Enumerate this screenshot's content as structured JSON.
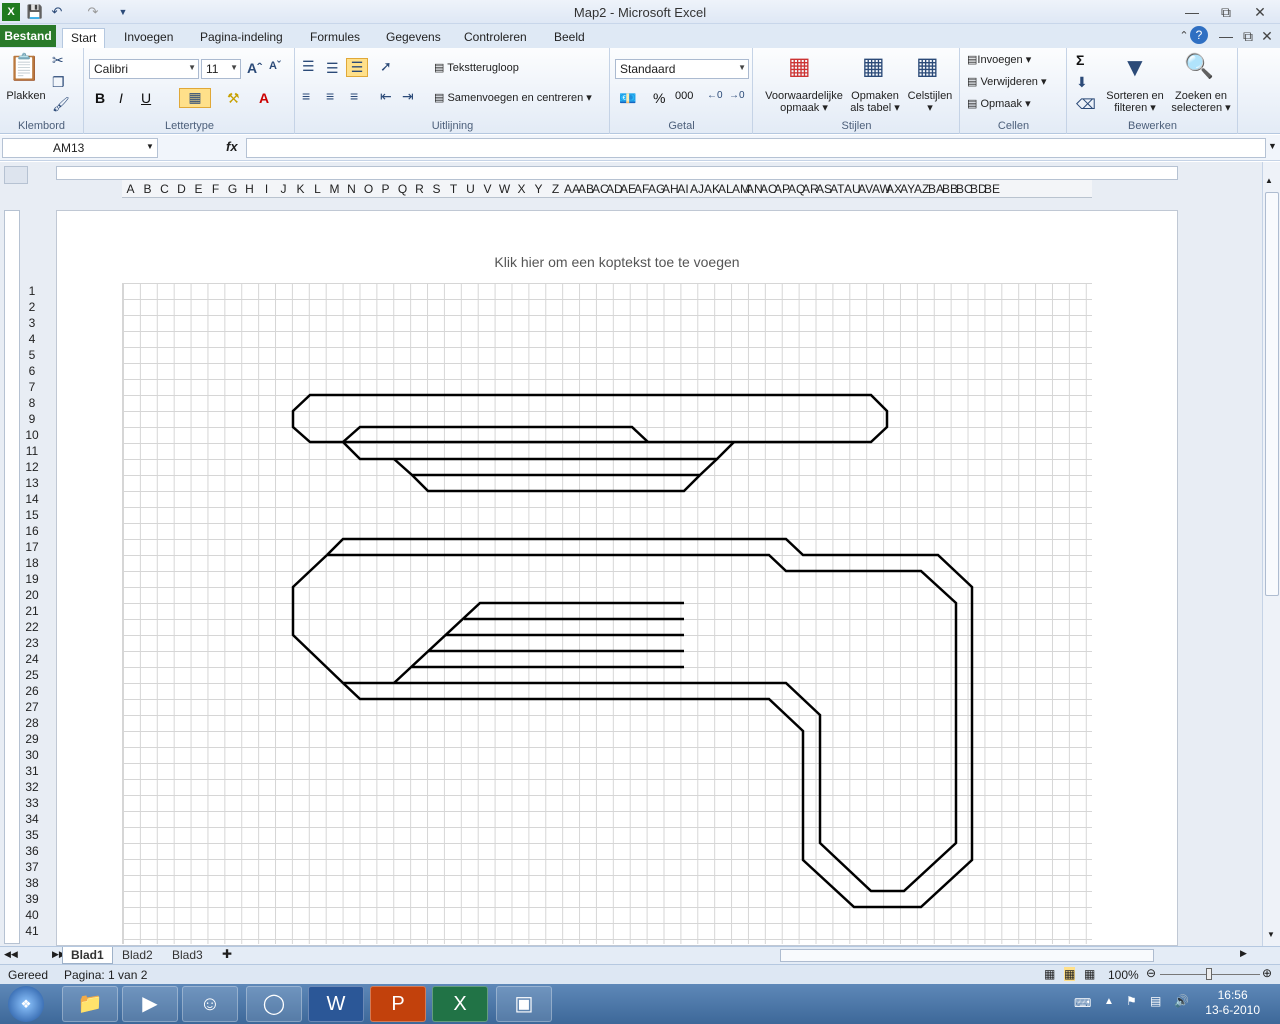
{
  "window": {
    "title": "Map2  -  Microsoft Excel"
  },
  "quick_access": {
    "save": "save-icon",
    "undo": "undo-icon",
    "redo": "redo-icon"
  },
  "tabs": [
    {
      "label": "Bestand"
    },
    {
      "label": "Start"
    },
    {
      "label": "Invoegen"
    },
    {
      "label": "Pagina-indeling"
    },
    {
      "label": "Formules"
    },
    {
      "label": "Gegevens"
    },
    {
      "label": "Controleren"
    },
    {
      "label": "Beeld"
    }
  ],
  "ribbon": {
    "clipboard": {
      "paste": "Plakken",
      "label": "Klembord"
    },
    "font": {
      "name": "Calibri",
      "size": "11",
      "label": "Lettertype",
      "bold": "B",
      "italic": "I",
      "underline": "U"
    },
    "alignment": {
      "wrap": "Tekstterugloop",
      "merge": "Samenvoegen en centreren",
      "label": "Uitlijning"
    },
    "number": {
      "format": "Standaard",
      "percent": "%",
      "thousands": "000",
      "label": "Getal"
    },
    "styles": {
      "conditional": "Voorwaardelijke",
      "conditional2": "opmaak",
      "format_table": "Opmaken",
      "format_table2": "als tabel",
      "cell_styles": "Celstijlen",
      "label": "Stijlen"
    },
    "cells": {
      "insert": "Invoegen",
      "delete": "Verwijderen",
      "format": "Opmaak",
      "label": "Cellen"
    },
    "editing": {
      "sort": "Sorteren en",
      "sort2": "filteren",
      "find": "Zoeken en",
      "find2": "selecteren",
      "label": "Bewerken"
    }
  },
  "formula_bar": {
    "name_box": "AM13",
    "fx": "fx",
    "value": ""
  },
  "columns": [
    "A",
    "B",
    "C",
    "D",
    "E",
    "F",
    "G",
    "H",
    "I",
    "J",
    "K",
    "L",
    "M",
    "N",
    "O",
    "P",
    "Q",
    "R",
    "S",
    "T",
    "U",
    "V",
    "W",
    "X",
    "Y",
    "Z",
    "AA",
    "AB",
    "AC",
    "AD",
    "AE",
    "AF",
    "AG",
    "AH",
    "AI",
    "AJ",
    "AK",
    "AL",
    "AM",
    "AN",
    "AO",
    "AP",
    "AQ",
    "AR",
    "AS",
    "AT",
    "AU",
    "AV",
    "AW",
    "AX",
    "AY",
    "AZ",
    "BA",
    "BB",
    "BC",
    "BD",
    "BE"
  ],
  "rows": [
    "1",
    "2",
    "3",
    "4",
    "5",
    "6",
    "7",
    "8",
    "9",
    "10",
    "11",
    "12",
    "13",
    "14",
    "15",
    "16",
    "17",
    "18",
    "19",
    "20",
    "21",
    "22",
    "23",
    "24",
    "25",
    "26",
    "27",
    "28",
    "29",
    "30",
    "31",
    "32",
    "33",
    "34",
    "35",
    "36",
    "37",
    "38",
    "39",
    "40",
    "41"
  ],
  "page": {
    "header_hint": "Klik hier om een koptekst toe te voegen"
  },
  "sheets": [
    {
      "label": "Blad1"
    },
    {
      "label": "Blad2"
    },
    {
      "label": "Blad3"
    }
  ],
  "status": {
    "ready": "Gereed",
    "page": "Pagina: 1 van 2",
    "zoom": "100%"
  },
  "taskbar": {
    "time": "16:56",
    "date": "13-6-2010"
  }
}
